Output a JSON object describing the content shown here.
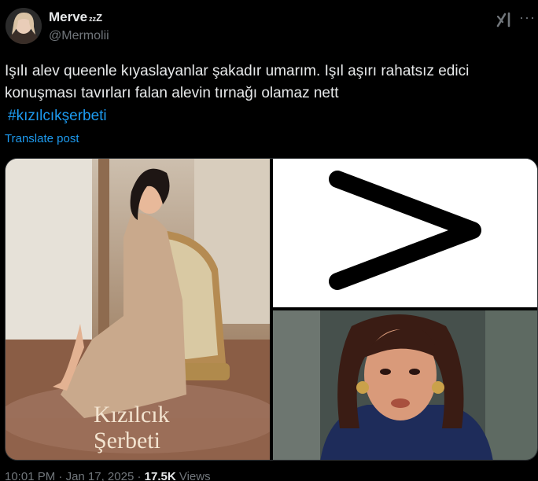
{
  "user": {
    "display_name": "Merve",
    "display_suffix_small": "zz",
    "display_suffix_big": "Z",
    "handle": "@Mermolii"
  },
  "icons": {
    "grok": "grok-icon",
    "more": "more-icon"
  },
  "tweet": {
    "text": "Işılı alev queenle kıyaslayanlar şakadır umarım. Işıl aşırı rahatsız edici konuşması tavırları falan alevin tırnağı olamaz nett",
    "hashtag": "#kızılcıkşerbeti",
    "translate_label": "Translate post"
  },
  "media": {
    "left_image_title_line1": "Kızılcık",
    "left_image_title_line2": "Şerbeti",
    "middle_symbol": ">"
  },
  "footer": {
    "time": "10:01 PM",
    "date": "Jan 17, 2025",
    "views_count": "17.5K",
    "views_label": "Views"
  },
  "colors": {
    "background": "#000000",
    "text": "#e7e9ea",
    "secondary": "#71767b",
    "link": "#1d9bf0"
  }
}
